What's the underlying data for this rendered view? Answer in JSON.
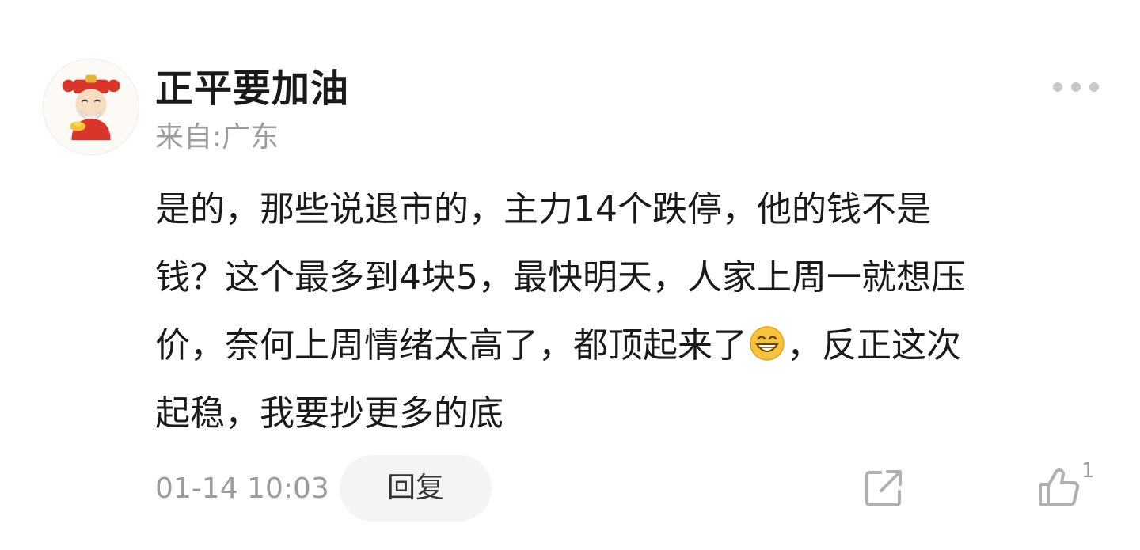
{
  "comment": {
    "username": "正平要加油",
    "location": "来自:广东",
    "body_lines": [
      "是的，那些说退市的，主力14个跌停，他的钱不是",
      "钱？这个最多到4块5，最快明天，人家上周一就想压",
      "价，奈何上周情绪太高了，都顶起来了",
      "，反正这次",
      "起稳，我要抄更多的底"
    ],
    "inline_emoji": "grinning-face-emoji",
    "timestamp": "01-14 10:03",
    "reply_label": "回复",
    "like_count": "1"
  },
  "icons": {
    "more": "more-dots-icon",
    "share": "share-icon",
    "like": "thumbs-up-icon",
    "avatar": "fortune-god-avatar"
  },
  "colors": {
    "username": "#1a1a1a",
    "secondary_text": "#9c9c9c",
    "reply_bg": "#f4f4f4",
    "icon_gray": "#b0b0b0"
  }
}
